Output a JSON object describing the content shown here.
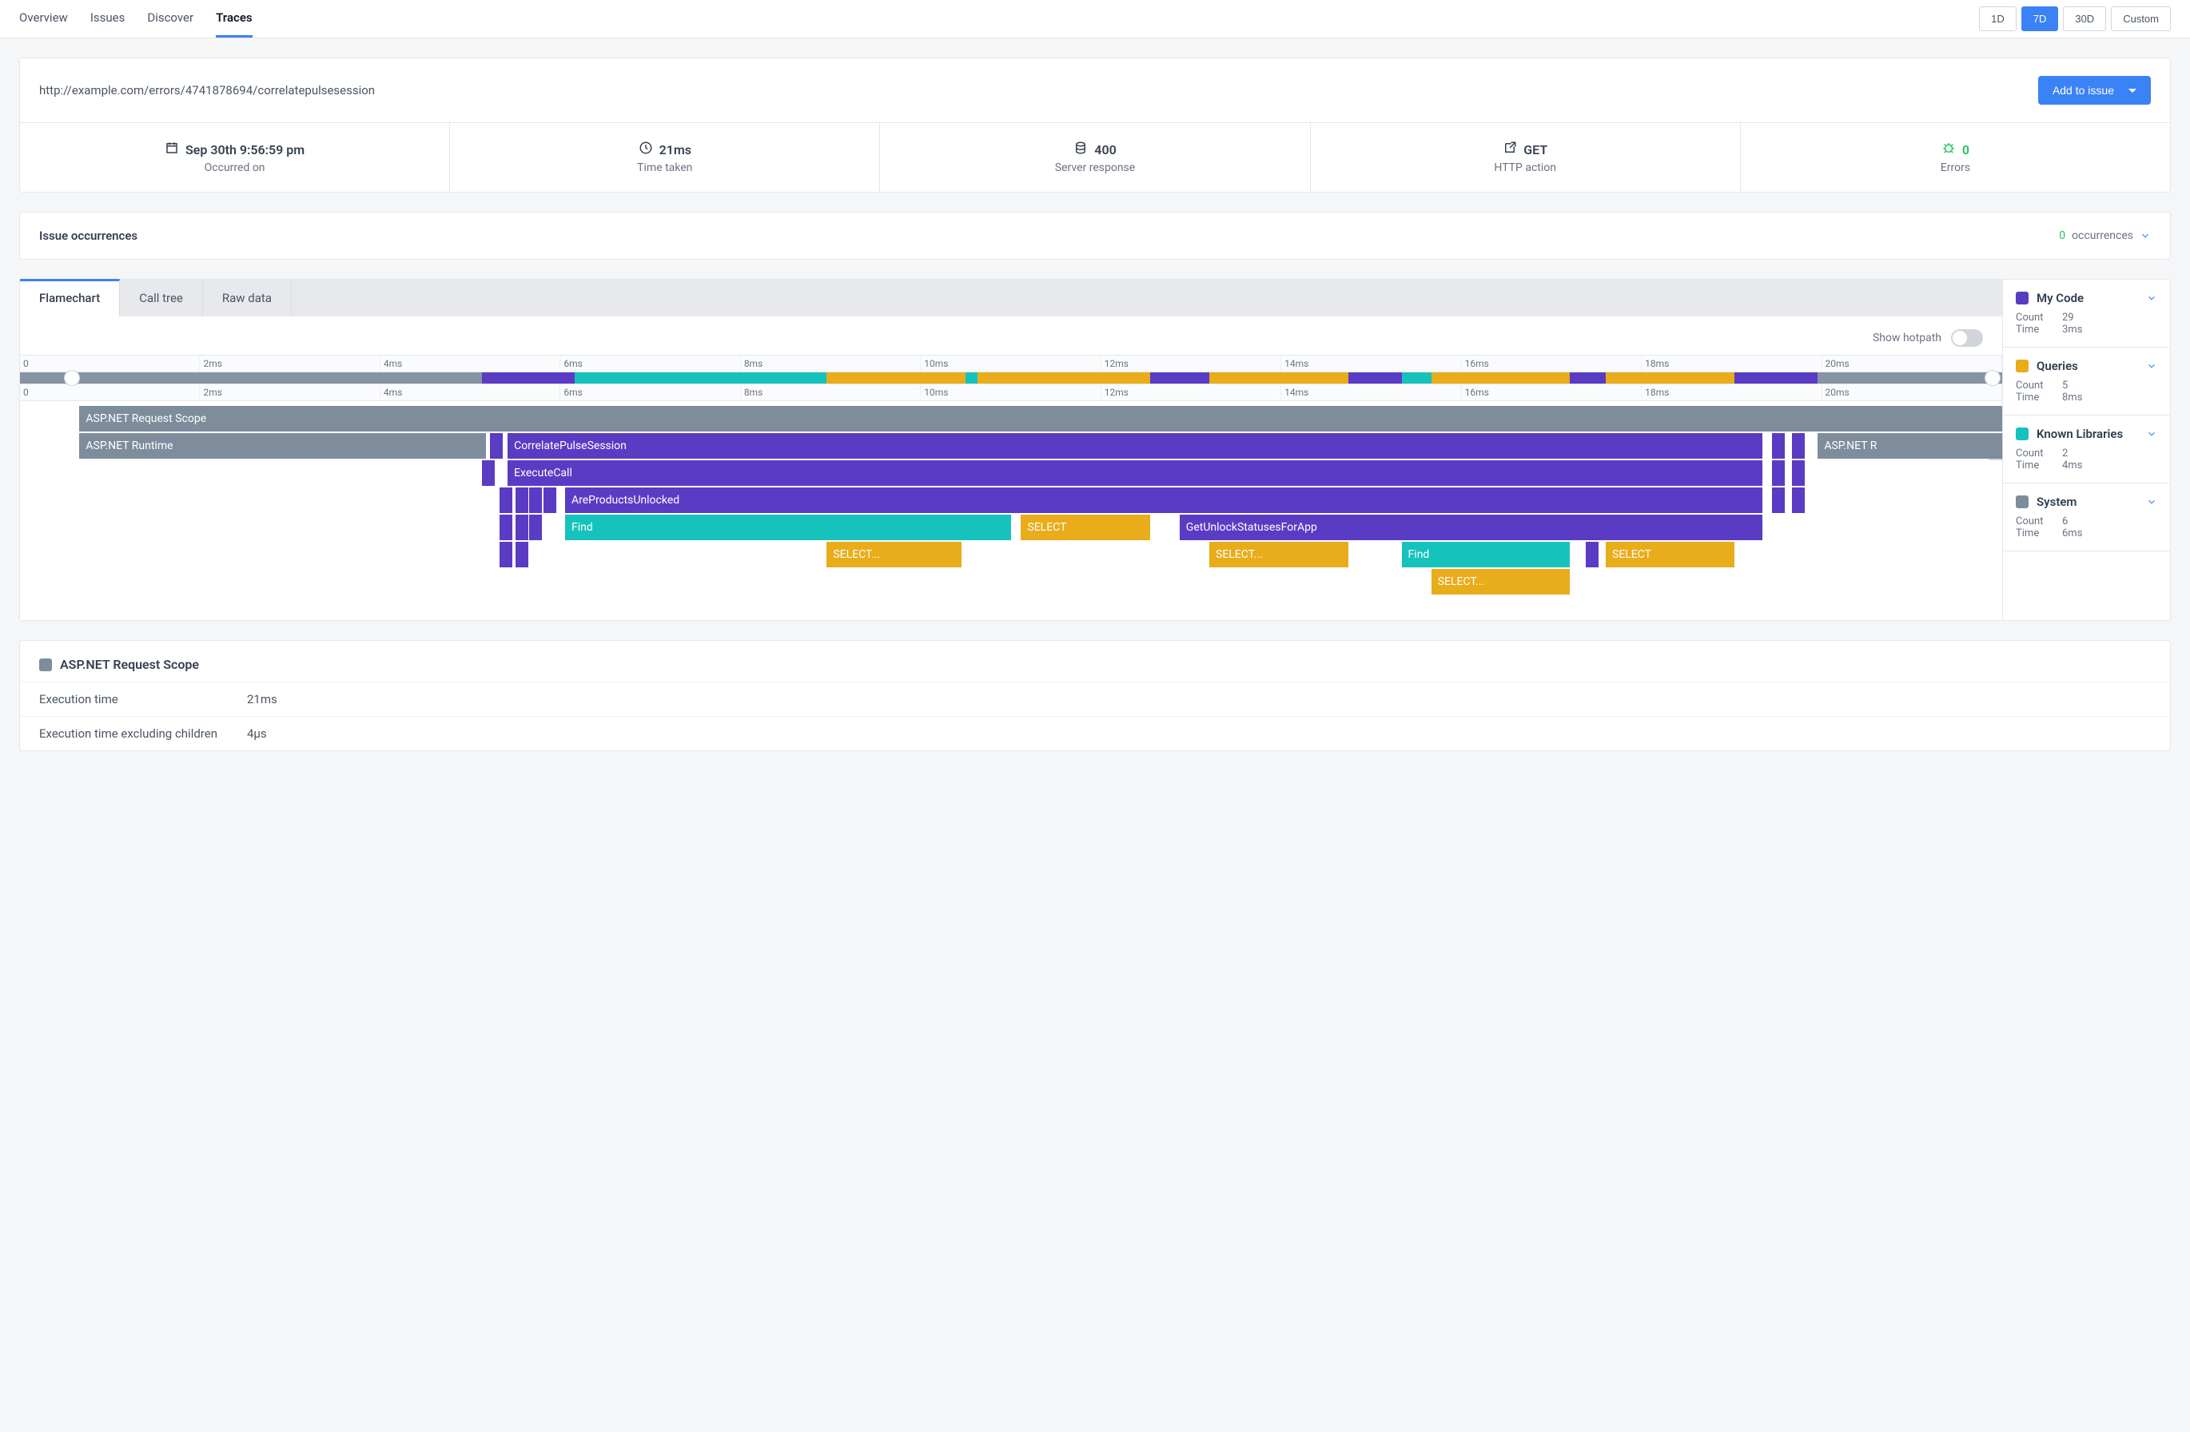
{
  "nav": {
    "tabs": [
      "Overview",
      "Issues",
      "Discover",
      "Traces"
    ],
    "active": 3,
    "timeranges": [
      "1D",
      "7D",
      "30D",
      "Custom"
    ],
    "time_active": 1
  },
  "url": "http://example.com/errors/4741878694/correlatepulsesession",
  "add_issue_label": "Add to issue",
  "stats": [
    {
      "icon": "calendar",
      "value": "Sep 30th 9:56:59 pm",
      "label": "Occurred on"
    },
    {
      "icon": "clock",
      "value": "21ms",
      "label": "Time taken"
    },
    {
      "icon": "db",
      "value": "400",
      "label": "Server response"
    },
    {
      "icon": "export",
      "value": "GET",
      "label": "HTTP action"
    },
    {
      "icon": "bug",
      "value": "0",
      "label": "Errors",
      "cls": "errors"
    }
  ],
  "occurrences": {
    "title": "Issue occurrences",
    "count": "0",
    "suffix": "occurrences"
  },
  "flame": {
    "tabs": [
      "Flamechart",
      "Call tree",
      "Raw data"
    ],
    "active": 0,
    "hotpath_label": "Show hotpath",
    "ticks": [
      "0",
      "2ms",
      "4ms",
      "6ms",
      "8ms",
      "10ms",
      "12ms",
      "14ms",
      "16ms",
      "18ms",
      "20ms"
    ],
    "spans": [
      [
        {
          "l": 3,
          "w": 97,
          "c": "c-system",
          "t": "ASP.NET Request Scope"
        }
      ],
      [
        {
          "l": 3,
          "w": 20.5,
          "c": "c-system",
          "t": "ASP.NET Runtime"
        },
        {
          "l": 23.7,
          "w": 0.6,
          "c": "c-mycode",
          "t": ""
        },
        {
          "l": 24.6,
          "w": 63.3,
          "c": "c-mycode",
          "t": "CorrelatePulseSession"
        },
        {
          "l": 88.4,
          "w": 0.6,
          "c": "c-mycode",
          "t": ""
        },
        {
          "l": 89.4,
          "w": 0.6,
          "c": "c-mycode",
          "t": ""
        },
        {
          "l": 90.7,
          "w": 9.3,
          "c": "c-system",
          "t": "ASP.NET R"
        }
      ],
      [
        {
          "l": 23.3,
          "w": 0.6,
          "c": "c-mycode",
          "t": ""
        },
        {
          "l": 24.6,
          "w": 63.3,
          "c": "c-mycode",
          "t": "ExecuteCall"
        },
        {
          "l": 88.4,
          "w": 0.6,
          "c": "c-mycode",
          "t": ""
        },
        {
          "l": 89.4,
          "w": 0.6,
          "c": "c-mycode",
          "t": ""
        }
      ],
      [
        {
          "l": 24.2,
          "w": 0.5,
          "c": "c-mycode",
          "t": ""
        },
        {
          "l": 25.0,
          "w": 0.5,
          "c": "c-mycode",
          "t": ""
        },
        {
          "l": 25.7,
          "w": 0.5,
          "c": "c-mycode",
          "t": ""
        },
        {
          "l": 26.4,
          "w": 0.5,
          "c": "c-mycode",
          "t": ""
        },
        {
          "l": 27.5,
          "w": 60.4,
          "c": "c-mycode",
          "t": "AreProductsUnlocked"
        },
        {
          "l": 88.4,
          "w": 0.6,
          "c": "c-mycode",
          "t": ""
        },
        {
          "l": 89.4,
          "w": 0.6,
          "c": "c-mycode",
          "t": ""
        }
      ],
      [
        {
          "l": 24.2,
          "w": 0.5,
          "c": "c-mycode",
          "t": ""
        },
        {
          "l": 25.0,
          "w": 0.5,
          "c": "c-mycode",
          "t": ""
        },
        {
          "l": 25.7,
          "w": 0.5,
          "c": "c-mycode",
          "t": ""
        },
        {
          "l": 27.5,
          "w": 22.5,
          "c": "c-known",
          "t": "Find"
        },
        {
          "l": 50.5,
          "w": 6.5,
          "c": "c-query",
          "t": "SELECT"
        },
        {
          "l": 58.5,
          "w": 29.4,
          "c": "c-mycode",
          "t": "GetUnlockStatusesForApp"
        }
      ],
      [
        {
          "l": 24.2,
          "w": 0.5,
          "c": "c-mycode",
          "t": ""
        },
        {
          "l": 25.0,
          "w": 0.5,
          "c": "c-mycode",
          "t": ""
        },
        {
          "l": 40.7,
          "w": 6.8,
          "c": "c-query",
          "t": "SELECT..."
        },
        {
          "l": 60,
          "w": 7,
          "c": "c-query",
          "t": "SELECT..."
        },
        {
          "l": 69.7,
          "w": 8.5,
          "c": "c-known",
          "t": "Find"
        },
        {
          "l": 79,
          "w": 0.6,
          "c": "c-mycode",
          "t": ""
        },
        {
          "l": 80,
          "w": 6.5,
          "c": "c-query",
          "t": "SELECT"
        }
      ],
      [
        {
          "l": 71.2,
          "w": 7,
          "c": "c-query",
          "t": "SELECT..."
        }
      ]
    ],
    "minimap": [
      {
        "l": 23.3,
        "w": 4.7,
        "c": "#5a3bc4"
      },
      {
        "l": 28,
        "w": 12.7,
        "c": "#16c3bc"
      },
      {
        "l": 40.7,
        "w": 7,
        "c": "#e9ac1b"
      },
      {
        "l": 47.7,
        "w": 0.6,
        "c": "#16c3bc"
      },
      {
        "l": 48.3,
        "w": 2.2,
        "c": "#e9ac1b"
      },
      {
        "l": 50.5,
        "w": 6.5,
        "c": "#e9ac1b"
      },
      {
        "l": 57,
        "w": 1.5,
        "c": "#5a3bc4"
      },
      {
        "l": 58.5,
        "w": 1.5,
        "c": "#5a3bc4"
      },
      {
        "l": 60,
        "w": 7,
        "c": "#e9ac1b"
      },
      {
        "l": 67,
        "w": 2.7,
        "c": "#5a3bc4"
      },
      {
        "l": 69.7,
        "w": 1.5,
        "c": "#16c3bc"
      },
      {
        "l": 71.2,
        "w": 7,
        "c": "#e9ac1b"
      },
      {
        "l": 78.2,
        "w": 1.8,
        "c": "#5a3bc4"
      },
      {
        "l": 80,
        "w": 6.5,
        "c": "#e9ac1b"
      },
      {
        "l": 86.5,
        "w": 4.2,
        "c": "#5a3bc4"
      }
    ]
  },
  "legend": [
    {
      "c": "#5a3bc4",
      "name": "My Code",
      "count": "29",
      "time": "3ms"
    },
    {
      "c": "#e9ac1b",
      "name": "Queries",
      "count": "5",
      "time": "8ms"
    },
    {
      "c": "#16c3bc",
      "name": "Known Libraries",
      "count": "2",
      "time": "4ms"
    },
    {
      "c": "#7e8c9c",
      "name": "System",
      "count": "6",
      "time": "6ms"
    }
  ],
  "legend_labels": {
    "count": "Count",
    "time": "Time"
  },
  "detail": {
    "title": "ASP.NET Request Scope",
    "rows": [
      {
        "k": "Execution time",
        "v": "21ms"
      },
      {
        "k": "Execution time excluding children",
        "v": "4µs"
      }
    ]
  }
}
